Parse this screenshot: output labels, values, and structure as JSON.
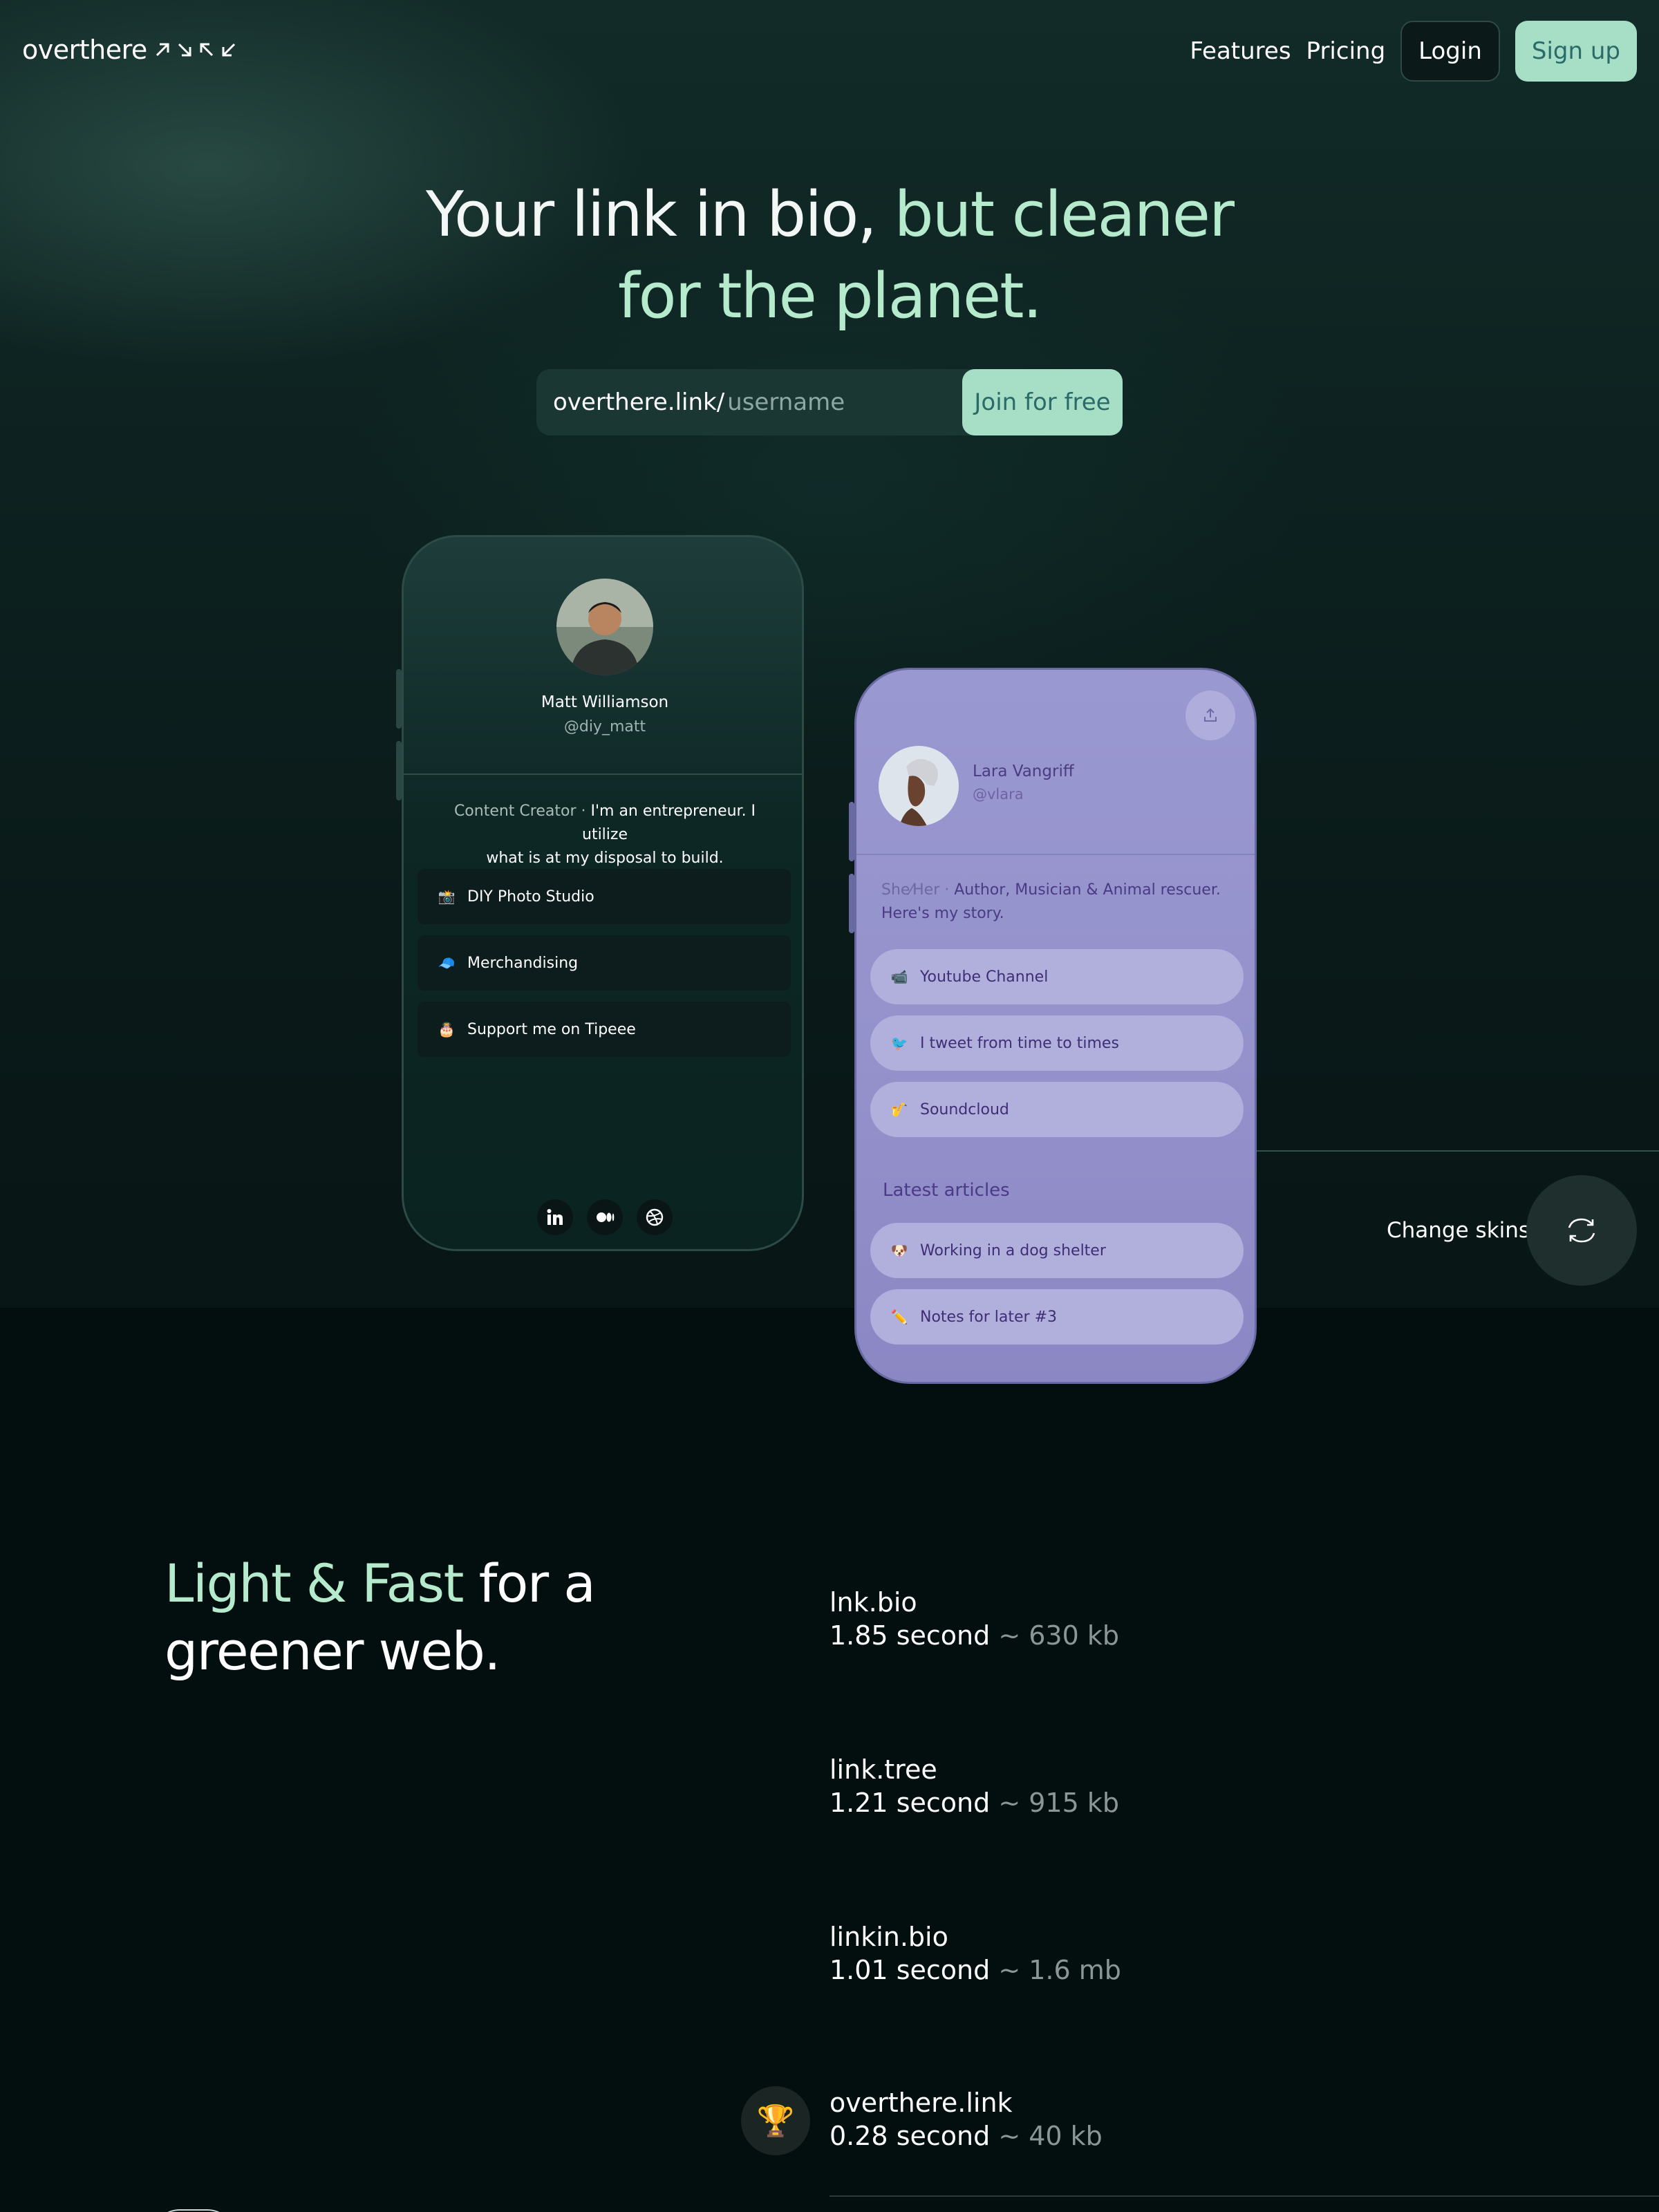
{
  "nav": {
    "logo_text": "overthere",
    "features": "Features",
    "pricing": "Pricing",
    "login": "Login",
    "signup": "Sign up"
  },
  "hero": {
    "headline_part1": "Your link in bio,",
    "headline_accent1": "but cleaner",
    "headline_accent2": "for the planet.",
    "prefix": "overthere.link/",
    "username_placeholder": "username",
    "join_button": "Join for free"
  },
  "phone_left": {
    "name": "Matt Williamson",
    "handle": "@diy_matt",
    "bio_muted": "Content Creator ·",
    "bio_line1_text": "I'm an entrepreneur. I utilize",
    "bio_line2": "what is at my disposal to build.",
    "links": [
      {
        "icon": "camera-icon",
        "emoji": "📸",
        "label": "DIY Photo Studio"
      },
      {
        "icon": "cap-icon",
        "emoji": "🧢",
        "label": "Merchandising"
      },
      {
        "icon": "gift-icon",
        "emoji": "🎂",
        "label": "Support me on Tipeee"
      }
    ],
    "socials": [
      "linkedin-icon",
      "medium-icon",
      "dribbble-icon"
    ]
  },
  "phone_right": {
    "name": "Lara Vangriff",
    "handle": "@vlara",
    "bio_muted": "She⁄Her ·",
    "bio_line1_text": "Author, Musician & Animal rescuer.",
    "bio_line2": "Here's my story.",
    "links": [
      {
        "icon": "video-icon",
        "emoji": "📹",
        "label": "Youtube Channel"
      },
      {
        "icon": "bird-icon",
        "emoji": "🐦",
        "label": "I tweet from time to times"
      },
      {
        "icon": "saxophone-icon",
        "emoji": "🎷",
        "label": "Soundcloud"
      }
    ],
    "section_title": "Latest articles",
    "articles": [
      {
        "icon": "dog-icon",
        "emoji": "🐶",
        "label": "Working in a dog shelter"
      },
      {
        "icon": "pencil-icon",
        "emoji": "✏️",
        "label": "Notes for later #3"
      }
    ]
  },
  "skins": {
    "label": "Change skins"
  },
  "light_fast": {
    "title_accent": "Light & Fast",
    "title_rest1": "for a",
    "title_rest2": "greener web."
  },
  "benchmarks": [
    {
      "name": "lnk.bio",
      "time": "1.85 second",
      "size": "~ 630 kb"
    },
    {
      "name": "link.tree",
      "time": "1.21 second",
      "size": "~ 915 kb"
    },
    {
      "name": "linkin.bio",
      "time": "1.01 second",
      "size": "~ 1.6 mb"
    },
    {
      "name": "overthere.link",
      "time": "0.28 second",
      "size": "~ 40 kb",
      "icon": "trophy-icon",
      "emoji": "🏆"
    }
  ],
  "colors": {
    "accent_green": "#b5eacd",
    "button_green": "#a6dfc6",
    "phone_purple": "#9491cb"
  }
}
